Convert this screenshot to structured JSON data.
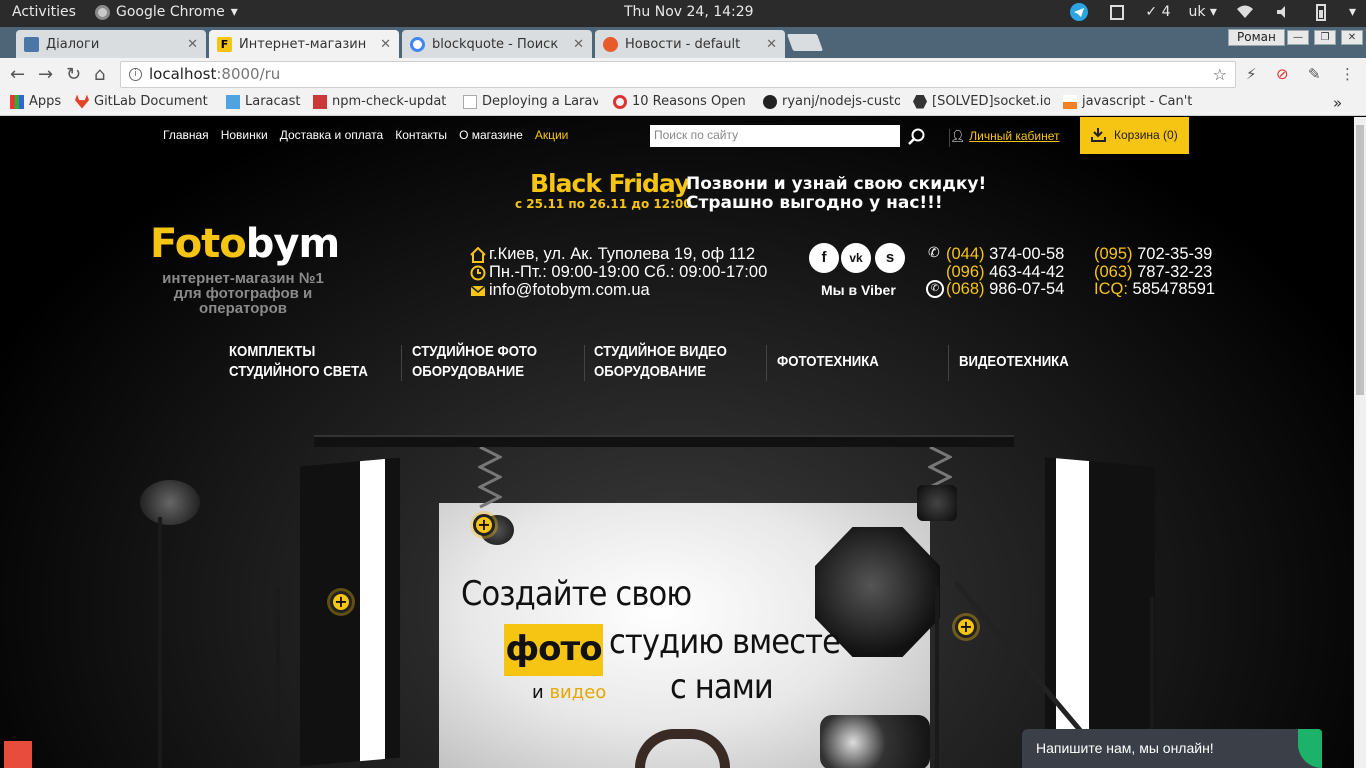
{
  "system_bar": {
    "activities": "Activities",
    "app_name": "Google Chrome",
    "clock": "Thu Nov 24, 14:29",
    "tray_count": "4",
    "keyboard_layout": "uk"
  },
  "tabs": [
    {
      "title": "Діалоги",
      "active": false
    },
    {
      "title": "Интернет-магазин",
      "active": true
    },
    {
      "title": "blockquote - Поиск",
      "active": false
    },
    {
      "title": "Новости - default",
      "active": false
    }
  ],
  "profile_name": "Роман",
  "address_bar": {
    "url_host": "localhost",
    "url_rest": ":8000/ru"
  },
  "bookmarks": [
    {
      "label": "Apps"
    },
    {
      "label": "GitLab Document"
    },
    {
      "label": "Laracast"
    },
    {
      "label": "npm-check-updat"
    },
    {
      "label": "Deploying a Larav"
    },
    {
      "label": "10 Reasons Open"
    },
    {
      "label": "ryanj/nodejs-custo"
    },
    {
      "label": "[SOLVED]socket.io"
    },
    {
      "label": "javascript - Can't"
    }
  ],
  "site": {
    "top_nav": [
      "Главная",
      "Новинки",
      "Доставка и оплата",
      "Контакты",
      "О магазине",
      "Акции"
    ],
    "search_placeholder": "Поиск по сайту",
    "cabinet": "Личный кабинет",
    "cart": "Корзина (0)",
    "promo": {
      "title": "Black Friday",
      "dates": "с 25.11 по 26.11 до 12:00",
      "line1": "Позвони и узнай свою скидку!",
      "line2": "Страшно выгодно у нас!!!"
    },
    "logo": {
      "part1": "Foto",
      "part2": "bym"
    },
    "tagline_1": "интернет-магазин №1",
    "tagline_2": "для фотографов и операторов",
    "address": "г.Киев, ул. Ак. Туполева 19, оф 112",
    "hours": "Пн.-Пт.: 09:00-19:00 Сб.: 09:00-17:00",
    "email": "info@fotobym.com.ua",
    "viber_label": "Мы в Viber",
    "phones": [
      {
        "code": "(044)",
        "number": "374-00-58"
      },
      {
        "code": "(096)",
        "number": "463-44-42"
      },
      {
        "code": "(068)",
        "number": "986-07-54"
      },
      {
        "code": "(095)",
        "number": "702-35-39"
      },
      {
        "code": "(063)",
        "number": "787-32-23"
      },
      {
        "code": "ICQ:",
        "number": "585478591"
      }
    ],
    "categories": [
      {
        "line1": "КОМПЛЕКТЫ",
        "line2": "СТУДИЙНОГО СВЕТА"
      },
      {
        "line1": "СТУДИЙНОЕ ФОТО",
        "line2": "ОБОРУДОВАНИЕ"
      },
      {
        "line1": "СТУДИЙНОЕ ВИДЕО",
        "line2": "ОБОРУДОВАНИЕ"
      },
      {
        "line1": "ФОТОТЕХНИКА",
        "line2": ""
      },
      {
        "line1": "ВИДЕОТЕХНИКА",
        "line2": ""
      }
    ],
    "hero": {
      "line1": "Создайте свою",
      "highlight": "фото",
      "line2": "студию вместе",
      "and": "и",
      "video": "видео",
      "line3": "с нами"
    },
    "chat_widget": "Напишите нам, мы онлайн!"
  },
  "colors": {
    "accent": "#f6c412",
    "chrome_tabbar": "#4e6578",
    "chat_bg": "#3b4048"
  }
}
